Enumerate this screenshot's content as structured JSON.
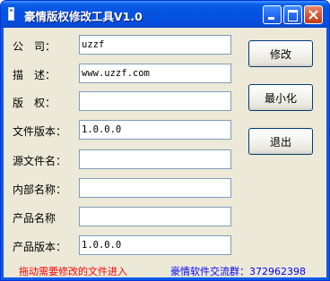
{
  "window": {
    "title": "豪情版权修改工具V1.0"
  },
  "titlebar_buttons": {
    "minimize_icon": "minimize-icon",
    "maximize_icon": "maximize-icon",
    "close_icon": "close-icon"
  },
  "form": {
    "company": {
      "label": "公　司：",
      "value": "uzzf"
    },
    "description": {
      "label": "描　述：",
      "value": "www.uzzf.com"
    },
    "copyright": {
      "label": "版　权：",
      "value": ""
    },
    "file_version": {
      "label": "文件版本：",
      "value": "1.0.0.0"
    },
    "original_filename": {
      "label": "源文件名：",
      "value": ""
    },
    "internal_name": {
      "label": "内部名称：",
      "value": ""
    },
    "product_name": {
      "label": "产品名称",
      "value": ""
    },
    "product_version": {
      "label": "产品版本：",
      "value": "1.0.0.0"
    }
  },
  "buttons": {
    "modify": "修改",
    "minimize": "最小化",
    "exit": "退出"
  },
  "status": {
    "hint": "拖动需要修改的文件进入",
    "group": "豪情软件交流群：372962398"
  },
  "colors": {
    "titlebar": "#0553e0",
    "client_background": "#ece9d8",
    "hint_text": "#ff0000",
    "group_text": "#0000ff"
  }
}
